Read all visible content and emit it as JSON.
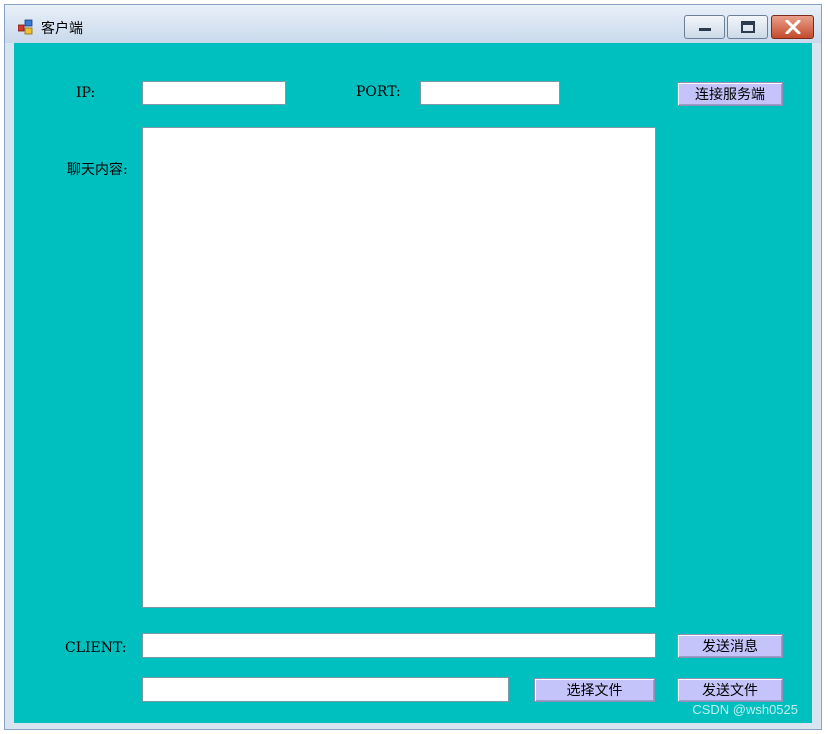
{
  "window": {
    "title": "客户端",
    "buttons": {
      "minimize_icon": "minimize-icon",
      "maximize_icon": "maximize-icon",
      "close_icon": "close-icon"
    }
  },
  "form": {
    "ip_label": "IP:",
    "ip_value": "",
    "port_label": "PORT:",
    "port_value": "",
    "connect_button": "连接服务端",
    "chat_label": "聊天内容:",
    "chat_content": "",
    "client_label": "CLIENT:",
    "message_value": "",
    "send_message_button": "发送消息",
    "file_path_value": "",
    "choose_file_button": "选择文件",
    "send_file_button": "发送文件"
  },
  "watermark": "CSDN @wsh0525",
  "colors": {
    "client_background": "#00bfbf",
    "button_background": "#c4c4fb",
    "close_button": "#c44a2c"
  }
}
